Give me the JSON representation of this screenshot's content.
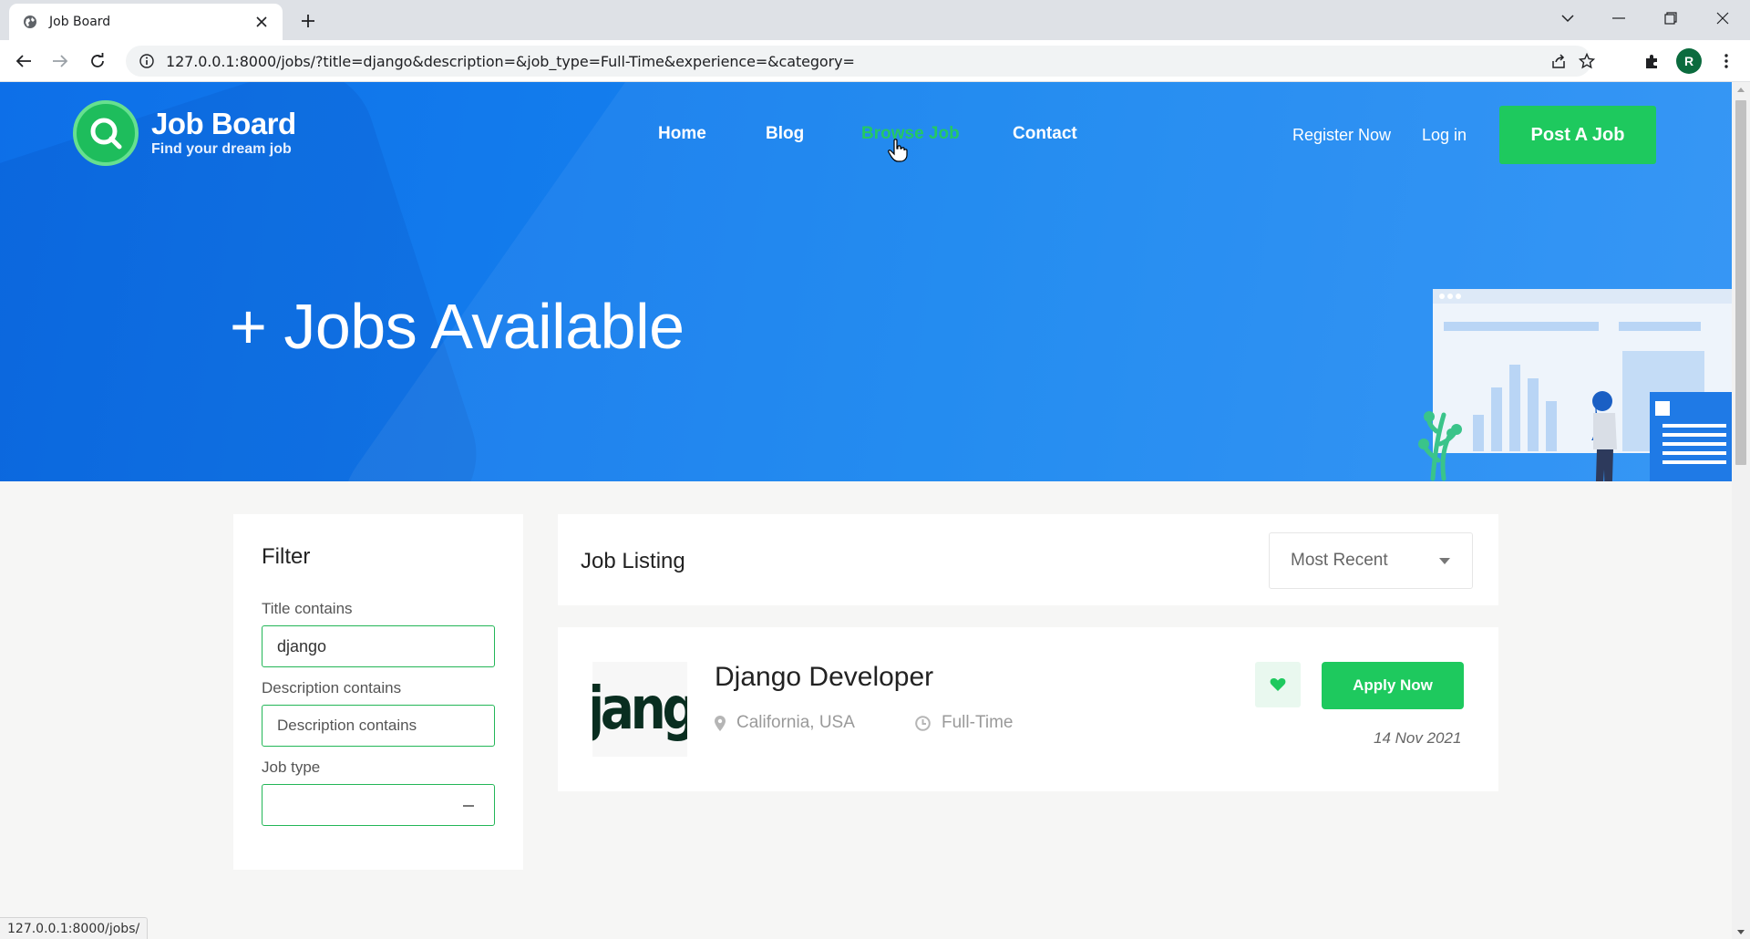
{
  "browser": {
    "tab_title": "Job Board",
    "url": "127.0.0.1:8000/jobs/?title=django&description=&job_type=Full-Time&experience=&category=",
    "profile_initial": "R",
    "status_url": "127.0.0.1:8000/jobs/"
  },
  "site": {
    "brand_name": "Job Board",
    "brand_tagline": "Find your dream job",
    "nav": {
      "home": "Home",
      "blog": "Blog",
      "browse": "Browse Job",
      "contact": "Contact"
    },
    "register": "Register Now",
    "login": "Log in",
    "post_job": "Post A Job",
    "active_nav": "Browse Job",
    "accent_color": "#1ec95e",
    "hero_color": "#1785f0"
  },
  "hero": {
    "title": "+ Jobs Available"
  },
  "filter": {
    "heading": "Filter",
    "title_label": "Title contains",
    "title_value": "django",
    "description_label": "Description contains",
    "description_placeholder": "Description contains",
    "job_type_label": "Job type"
  },
  "listing": {
    "heading": "Job Listing",
    "sort_selected": "Most Recent",
    "jobs": [
      {
        "logo_text": "django",
        "title": "Django Developer",
        "location": "California, USA",
        "type": "Full-Time",
        "apply_label": "Apply Now",
        "date": "14 Nov 2021"
      }
    ]
  }
}
